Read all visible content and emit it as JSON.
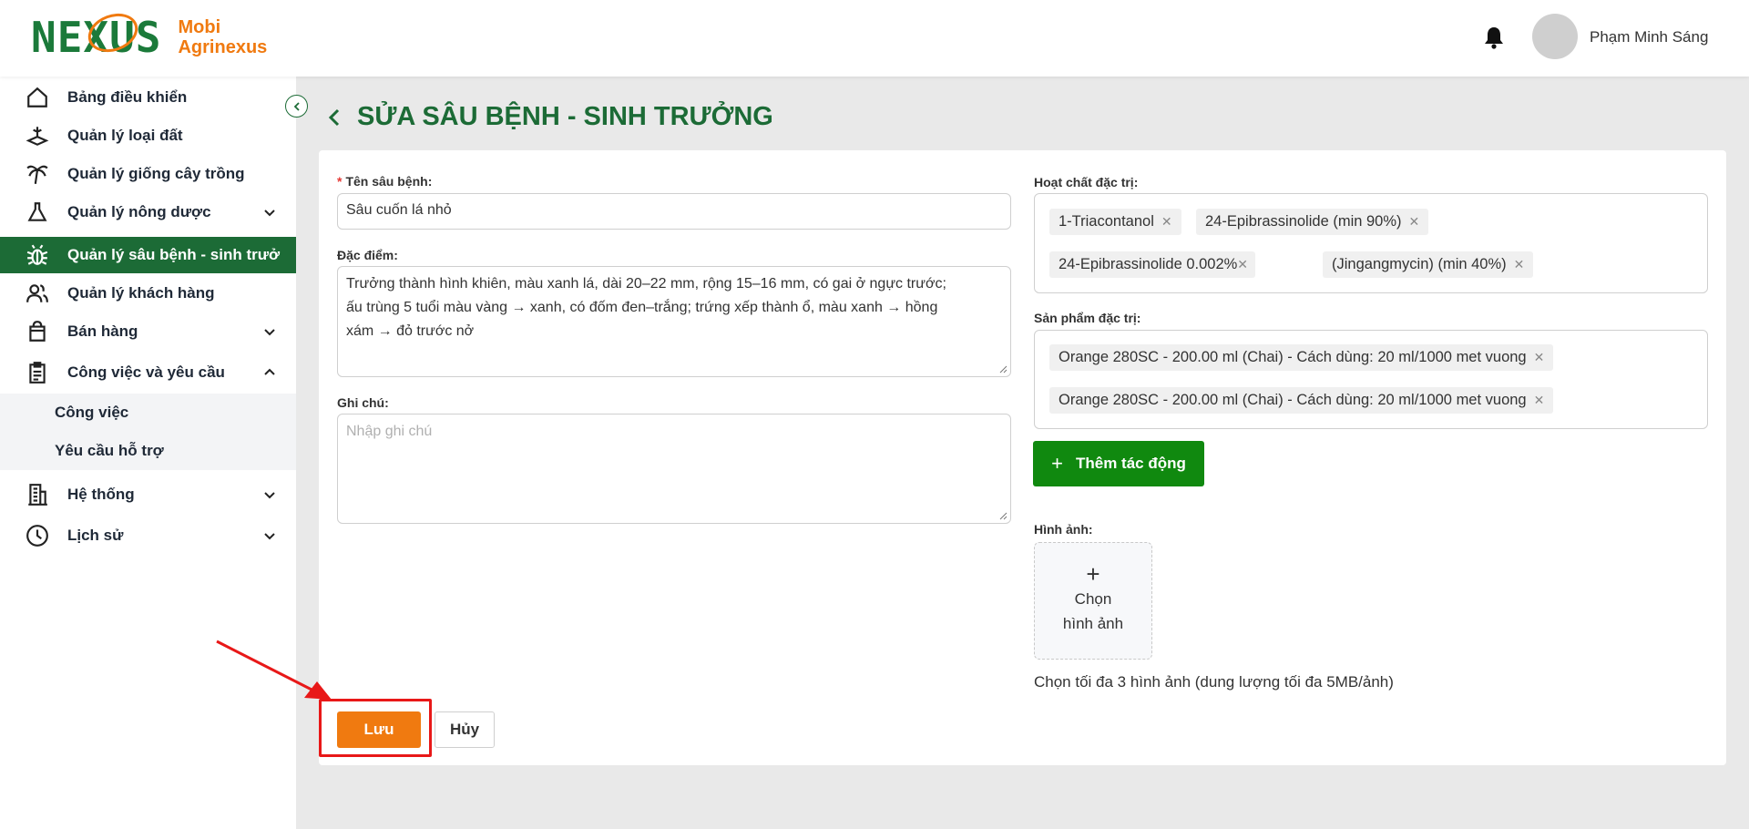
{
  "header": {
    "logo_text": "NEXUS",
    "brand_line1": "Mobi",
    "brand_line2": "Agrinexus",
    "username": "Phạm Minh Sáng"
  },
  "sidebar": {
    "items": [
      {
        "label": "Bảng điều khiển",
        "icon": "home-icon"
      },
      {
        "label": "Quản lý loại đất",
        "icon": "soil-icon"
      },
      {
        "label": "Quản lý giống cây trồng",
        "icon": "palm-tree-icon"
      },
      {
        "label": "Quản lý nông dược",
        "icon": "flask-icon"
      },
      {
        "label": "Quản lý sâu bệnh - sinh trưởng",
        "icon": "bug-icon",
        "active": true
      },
      {
        "label": "Quản lý khách hàng",
        "icon": "users-icon"
      },
      {
        "label": "Bán hàng",
        "icon": "shopping-bag-icon"
      },
      {
        "label": "Công việc và yêu cầu",
        "icon": "clipboard-icon",
        "expanded": true
      },
      {
        "label": "Hệ thống",
        "icon": "building-icon"
      },
      {
        "label": "Lịch sử",
        "icon": "history-icon"
      }
    ],
    "sub_items": [
      "Công việc",
      "Yêu cầu hỗ trợ"
    ]
  },
  "page": {
    "title": "SỬA SÂU BỆNH - SINH TRƯỞNG"
  },
  "form": {
    "name_label": "Tên sâu bệnh:",
    "name_value": "Sâu cuốn lá nhỏ",
    "features_label": "Đặc điểm:",
    "features_value": "Trưởng thành hình khiên, màu xanh lá, dài 20–22 mm, rộng 15–16 mm, có gai ở ngực trước;\nấu trùng 5 tuổi màu vàng → xanh, có đốm đen–trắng; trứng xếp thành ổ, màu xanh → hồng\nxám → đỏ trước nở",
    "notes_label": "Ghi chú:",
    "notes_placeholder": "Nhập ghi chú",
    "active_ingredients_label": "Hoạt chất đặc trị:",
    "active_ingredients": [
      "1-Triacontanol",
      "24-Epibrassinolide (min 90%)",
      "24-Epibrassinolide 0.002%",
      "(Jingangmycin) (min 40%)"
    ],
    "products_label": "Sản phẩm đặc trị:",
    "products": [
      "Orange 280SC - 200.00 ml (Chai)  - Cách dùng: 20 ml/1000 met vuong",
      "Orange 280SC - 200.00 ml (Chai)  - Cách dùng: 20 ml/1000 met vuong"
    ],
    "add_effect_label": "Thêm tác động",
    "images_label": "Hình ảnh:",
    "upload_line1": "Chọn",
    "upload_line2": "hình ảnh",
    "upload_hint": "Chọn tối đa 3 hình ảnh (dung lượng tối đa 5MB/ảnh)",
    "save_label": "Lưu",
    "cancel_label": "Hủy"
  },
  "colors": {
    "primary_green": "#1c6b36",
    "button_green": "#10890f",
    "accent_orange": "#f07a10",
    "annotation_red": "#e81818"
  }
}
